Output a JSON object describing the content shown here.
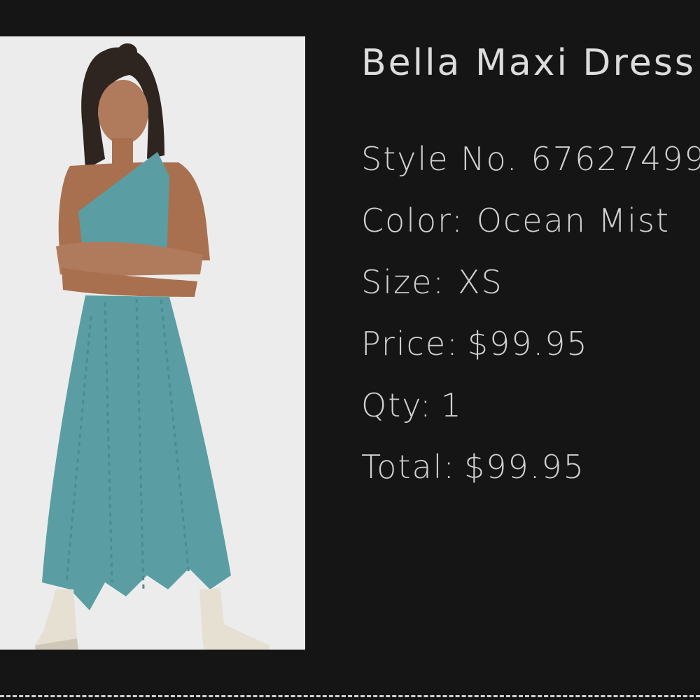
{
  "product": {
    "title": "Bella Maxi Dress",
    "style": {
      "label": "Style No.",
      "value": "67627499"
    },
    "color": {
      "label": "Color:",
      "value": "Ocean Mist"
    },
    "size": {
      "label": "Size:",
      "value": "XS"
    },
    "price": {
      "label": "Price:",
      "value": "$99.95"
    },
    "qty": {
      "label": "Qty:",
      "value": "1"
    },
    "total": {
      "label": "Total:",
      "value": "$99.95"
    }
  },
  "colors": {
    "page_background": "#161515",
    "photo_background": "#ececec",
    "dress": "#5a9ea3",
    "text": "#d4d4d4"
  },
  "image": {
    "subject": "model-in-teal-one-shoulder-maxi-dress-with-cream-boots"
  }
}
